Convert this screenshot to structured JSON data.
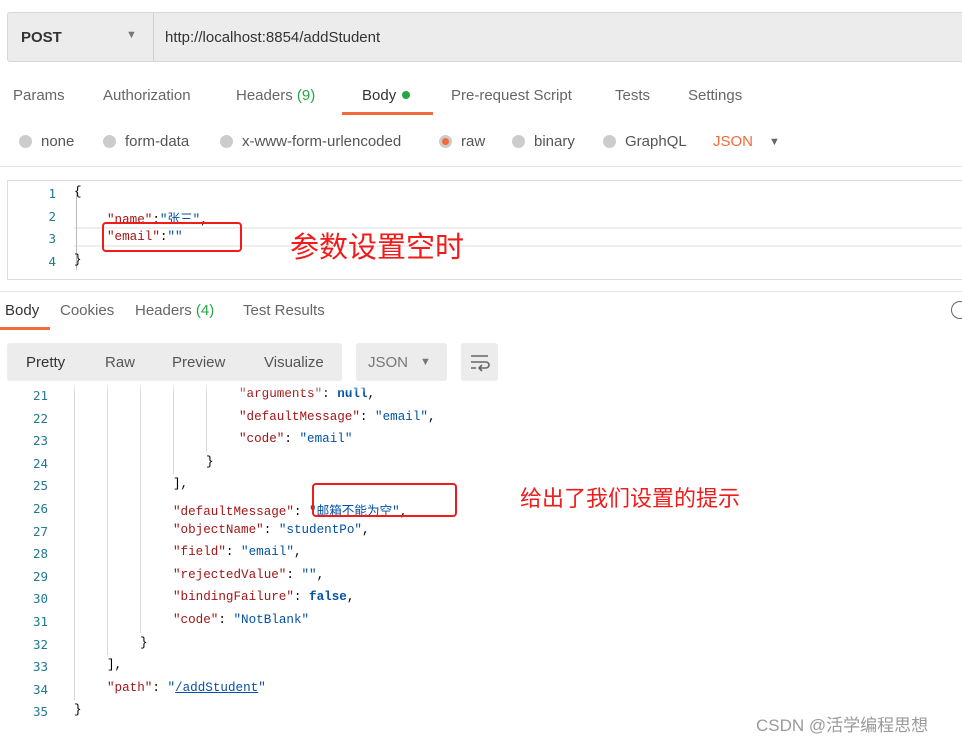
{
  "request": {
    "method": "POST",
    "url": "http://localhost:8854/addStudent"
  },
  "request_tabs": [
    {
      "label": "Params"
    },
    {
      "label": "Authorization"
    },
    {
      "label": "Headers",
      "count": "(9)"
    },
    {
      "label": "Body"
    },
    {
      "label": "Pre-request Script"
    },
    {
      "label": "Tests"
    },
    {
      "label": "Settings"
    }
  ],
  "body_types": [
    {
      "label": "none"
    },
    {
      "label": "form-data"
    },
    {
      "label": "x-www-form-urlencoded"
    },
    {
      "label": "raw",
      "selected": true
    },
    {
      "label": "binary"
    },
    {
      "label": "GraphQL"
    }
  ],
  "body_format": "JSON",
  "request_body": [
    {
      "n": "1",
      "indent": 0,
      "parts": [
        [
          "p",
          "{"
        ]
      ]
    },
    {
      "n": "2",
      "indent": 1,
      "parts": [
        [
          "k",
          "\"name\""
        ],
        [
          "p",
          ":"
        ],
        [
          "v",
          "\"张三\""
        ],
        [
          "p",
          ","
        ]
      ]
    },
    {
      "n": "3",
      "indent": 1,
      "parts": [
        [
          "k",
          "\"email\""
        ],
        [
          "p",
          ":"
        ],
        [
          "v",
          "\"\""
        ]
      ]
    },
    {
      "n": "4",
      "indent": 0,
      "parts": [
        [
          "p",
          "}"
        ]
      ]
    }
  ],
  "annotation_request": "参数设置空时",
  "response_tabs": [
    {
      "label": "Body"
    },
    {
      "label": "Cookies"
    },
    {
      "label": "Headers",
      "count": "(4)"
    },
    {
      "label": "Test Results"
    }
  ],
  "view_modes": [
    "Pretty",
    "Raw",
    "Preview",
    "Visualize"
  ],
  "response_format": "JSON",
  "response_body": [
    {
      "n": "21",
      "indent": 5,
      "parts": [
        [
          "k",
          "\"arguments\""
        ],
        [
          "p",
          ": "
        ],
        [
          "b",
          "null"
        ],
        [
          "p",
          ","
        ]
      ]
    },
    {
      "n": "22",
      "indent": 5,
      "parts": [
        [
          "k",
          "\"defaultMessage\""
        ],
        [
          "p",
          ": "
        ],
        [
          "v",
          "\"email\""
        ],
        [
          "p",
          ","
        ]
      ]
    },
    {
      "n": "23",
      "indent": 5,
      "parts": [
        [
          "k",
          "\"code\""
        ],
        [
          "p",
          ": "
        ],
        [
          "v",
          "\"email\""
        ]
      ]
    },
    {
      "n": "24",
      "indent": 4,
      "parts": [
        [
          "p",
          "}"
        ]
      ]
    },
    {
      "n": "25",
      "indent": 3,
      "parts": [
        [
          "p",
          "],"
        ]
      ]
    },
    {
      "n": "26",
      "indent": 3,
      "parts": [
        [
          "k",
          "\"defaultMessage\""
        ],
        [
          "p",
          ": "
        ],
        [
          "v",
          "\"邮箱不能为空\""
        ],
        [
          "p",
          ","
        ]
      ]
    },
    {
      "n": "27",
      "indent": 3,
      "parts": [
        [
          "k",
          "\"objectName\""
        ],
        [
          "p",
          ": "
        ],
        [
          "v",
          "\"studentPo\""
        ],
        [
          "p",
          ","
        ]
      ]
    },
    {
      "n": "28",
      "indent": 3,
      "parts": [
        [
          "k",
          "\"field\""
        ],
        [
          "p",
          ": "
        ],
        [
          "v",
          "\"email\""
        ],
        [
          "p",
          ","
        ]
      ]
    },
    {
      "n": "29",
      "indent": 3,
      "parts": [
        [
          "k",
          "\"rejectedValue\""
        ],
        [
          "p",
          ": "
        ],
        [
          "v",
          "\"\""
        ],
        [
          "p",
          ","
        ]
      ]
    },
    {
      "n": "30",
      "indent": 3,
      "parts": [
        [
          "k",
          "\"bindingFailure\""
        ],
        [
          "p",
          ": "
        ],
        [
          "b",
          "false"
        ],
        [
          "p",
          ","
        ]
      ]
    },
    {
      "n": "31",
      "indent": 3,
      "parts": [
        [
          "k",
          "\"code\""
        ],
        [
          "p",
          ": "
        ],
        [
          "v",
          "\"NotBlank\""
        ]
      ]
    },
    {
      "n": "32",
      "indent": 2,
      "parts": [
        [
          "p",
          "}"
        ]
      ]
    },
    {
      "n": "33",
      "indent": 1,
      "parts": [
        [
          "p",
          "],"
        ]
      ]
    },
    {
      "n": "34",
      "indent": 1,
      "parts": [
        [
          "k",
          "\"path\""
        ],
        [
          "p",
          ": "
        ],
        [
          "v",
          "\""
        ],
        [
          "vu",
          "/addStudent"
        ],
        [
          "v",
          "\""
        ]
      ]
    },
    {
      "n": "35",
      "indent": 0,
      "parts": [
        [
          "p",
          "}"
        ]
      ]
    }
  ],
  "annotation_response": "给出了我们设置的提示",
  "watermark": "CSDN @活学编程思想",
  "colors": {
    "accent": "#f26b3a",
    "count_green": "#26a544",
    "annotation_red": "#f21b1b"
  }
}
